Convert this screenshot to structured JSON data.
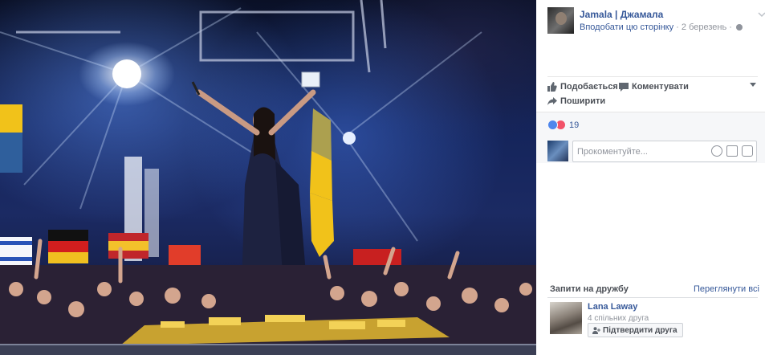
{
  "post": {
    "page_name": "Jamala | Джамала",
    "follow_label": "Вподобати цю сторінку",
    "separator": "·",
    "date": "2 березень",
    "separator2": "·"
  },
  "actions": {
    "like_label": "Подобається",
    "comment_label": "Коментувати",
    "share_label": "Поширити"
  },
  "feedback": {
    "reaction_count": "19",
    "comment_placeholder": "Прокоментуйте..."
  },
  "friend_requests": {
    "title": "Запити на дружбу",
    "see_all": "Переглянути всі",
    "items": [
      {
        "name": "Lana Laway",
        "mutual": "4 спільних друга",
        "confirm_label": "Підтвердити друга"
      }
    ]
  },
  "icons": {
    "like": "thumbs-up-icon",
    "comment": "speech-bubble-icon",
    "share": "share-arrow-icon",
    "reaction_like": "like-reaction-icon",
    "reaction_love": "love-reaction-icon",
    "emoji": "emoji-icon",
    "camera": "camera-icon",
    "sticker": "sticker-icon",
    "globe": "globe-icon",
    "chevron": "chevron-down-icon",
    "add_friend": "add-friend-icon"
  },
  "colors": {
    "link": "#365899",
    "text_muted": "#90949c",
    "panel_bg": "#f6f7f9",
    "like_blue": "#4e86ec",
    "love_red": "#f25268"
  }
}
